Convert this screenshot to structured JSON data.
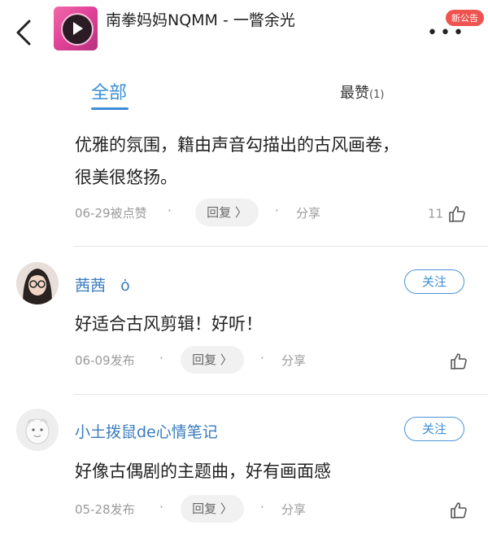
{
  "header": {
    "title": "南拳妈妈NQMM - 一瞥余光",
    "notice_badge": "新公告",
    "more_icon": "more-dots-icon",
    "back_icon": "back-chevron-icon"
  },
  "tabs": {
    "all_label": "全部",
    "best_label": "最赞",
    "best_count": "(1)"
  },
  "comments": [
    {
      "text_line1": "优雅的氛围，籍由声音勾描出的古风画卷，",
      "text_line2": "很美很悠扬。",
      "meta": "06-29被点赞",
      "reply": "回复 〉",
      "share": "分享",
      "likes": "11"
    },
    {
      "user": "茜茜",
      "user_icon": "ȯ",
      "follow": "关注",
      "text": "好适合古风剪辑！好听！",
      "meta": "06-09发布",
      "reply": "回复 〉",
      "share": "分享"
    },
    {
      "user": "小土拨鼠de心情笔记",
      "follow": "关注",
      "text": "好像古偶剧的主题曲，好有画面感",
      "meta": "05-28发布",
      "reply": "回复 〉",
      "share": "分享"
    }
  ],
  "colors": {
    "accent": "#3a8fd6",
    "badge": "#ef5350",
    "meta_gray": "#9a9a9a"
  }
}
